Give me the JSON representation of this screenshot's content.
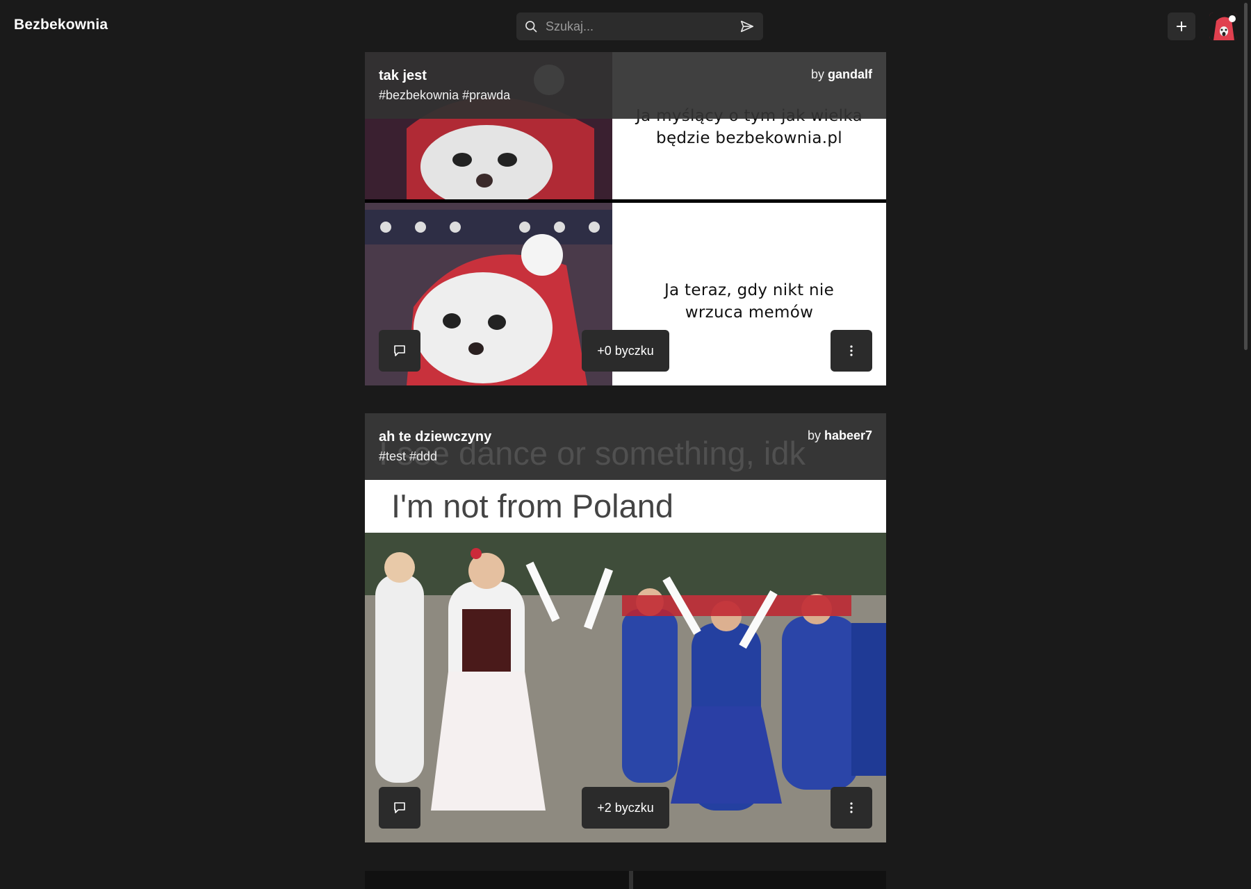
{
  "app": {
    "title": "Bezbekownia"
  },
  "search": {
    "placeholder": "Szukaj..."
  },
  "posts": [
    {
      "title": "tak jest",
      "tags": "#bezbekownia #prawda",
      "author_prefix": "by",
      "author": "gandalf",
      "meme_top_caption": "Ja myślący o tym jak wielka będzie bezbekownia.pl",
      "meme_bottom_caption": "Ja teraz, gdy nikt nie wrzuca memów",
      "likes_label": "+0 byczku"
    },
    {
      "title": "ah te dziewczyny",
      "tags": "#test #ddd",
      "author_prefix": "by",
      "author": "habeer7",
      "meme_ghost_text": "I see dance or something, idk",
      "meme_headline": "I'm not from Poland",
      "likes_label": "+2 byczku"
    }
  ],
  "icons": {
    "search": "search-icon",
    "send": "send-icon",
    "add": "plus-icon",
    "comment": "comment-icon",
    "more": "more-vertical-icon"
  },
  "colors": {
    "background": "#1a1a1a",
    "surface": "#2b2b2b",
    "avatar": "#d9374a"
  }
}
